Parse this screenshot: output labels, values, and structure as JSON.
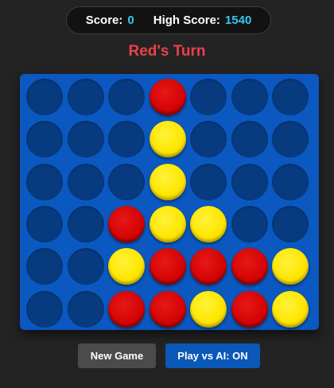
{
  "header": {
    "score_label": "Score:",
    "score_value": "0",
    "high_score_label": "High Score:",
    "high_score_value": "1540"
  },
  "status": {
    "turn_text": "Red's Turn"
  },
  "board": {
    "rows": 6,
    "columns": 7,
    "grid": [
      [
        "empty",
        "empty",
        "empty",
        "red",
        "empty",
        "empty",
        "empty"
      ],
      [
        "empty",
        "empty",
        "empty",
        "yellow",
        "empty",
        "empty",
        "empty"
      ],
      [
        "empty",
        "empty",
        "empty",
        "yellow",
        "empty",
        "empty",
        "empty"
      ],
      [
        "empty",
        "empty",
        "red",
        "yellow",
        "yellow",
        "empty",
        "empty"
      ],
      [
        "empty",
        "empty",
        "yellow",
        "red",
        "red",
        "red",
        "yellow"
      ],
      [
        "empty",
        "empty",
        "red",
        "red",
        "yellow",
        "red",
        "yellow"
      ]
    ]
  },
  "controls": {
    "new_game_label": "New Game",
    "ai_toggle_label": "Play vs AI: ON"
  },
  "colors": {
    "background": "#232323",
    "board": "#0b58c0",
    "empty_slot": "#073a7e",
    "red_disc": "#d60505",
    "yellow_disc": "#ffe600",
    "score_value": "#37c6f0",
    "turn_text": "#e8424b",
    "ai_button": "#0a58b8",
    "new_game_button": "#4b4b4b"
  }
}
